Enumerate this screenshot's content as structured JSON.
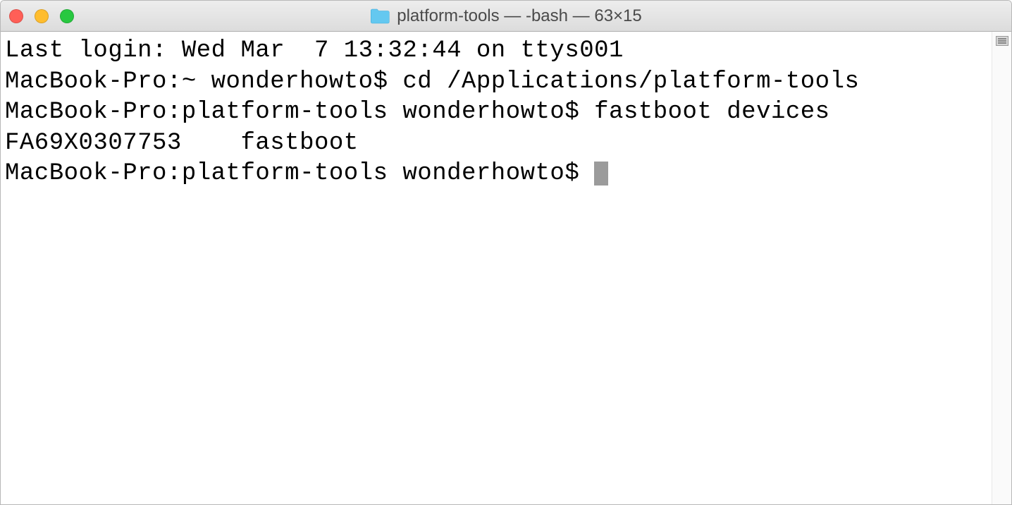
{
  "window": {
    "title": "platform-tools — -bash — 63×15"
  },
  "terminal": {
    "lines": [
      "Last login: Wed Mar  7 13:32:44 on ttys001",
      "MacBook-Pro:~ wonderhowto$ cd /Applications/platform-tools",
      "MacBook-Pro:platform-tools wonderhowto$ fastboot devices",
      "FA69X0307753    fastboot",
      "MacBook-Pro:platform-tools wonderhowto$ "
    ]
  }
}
